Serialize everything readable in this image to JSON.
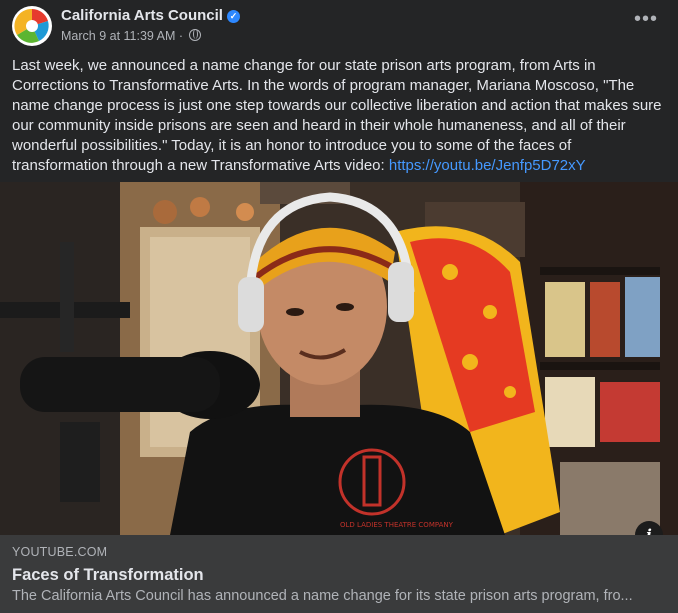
{
  "post": {
    "page_name": "California Arts Council",
    "timestamp": "March 9 at 11:39 AM",
    "separator": " · ",
    "body_text": "Last week, we announced a name change for our state prison arts program, from Arts in Corrections to Transformative Arts. In the words of program manager, Mariana Moscoso, \"The name change process is just one step towards our collective liberation and action that makes sure our community inside prisons are seen and heard in their whole humaneness, and all of their wonderful possibilities.\" Today, it is an honor to introduce you to some of the faces of transformation through a new Transformative Arts video: ",
    "link_text": "https://youtu.be/Jenfp5D72xY",
    "more_label": "•••",
    "verified_mark": "✓"
  },
  "video": {
    "shirt_text": "OLD LADIES THEATRE COMPANY",
    "info_icon_label": "i"
  },
  "link_preview": {
    "domain": "YOUTUBE.COM",
    "title": "Faces of Transformation",
    "description": "The California Arts Council has announced a name change for its state prison arts program, fro..."
  },
  "colors": {
    "background": "#242526",
    "text_primary": "#e4e6eb",
    "text_secondary": "#b0b3b8",
    "link": "#4599ff",
    "verified": "#2d88ff",
    "preview_bg": "#3a3b3c"
  },
  "icons": [
    "california-arts-council-logo",
    "verified-badge-icon",
    "globe-icon",
    "more-options-icon",
    "info-icon"
  ]
}
